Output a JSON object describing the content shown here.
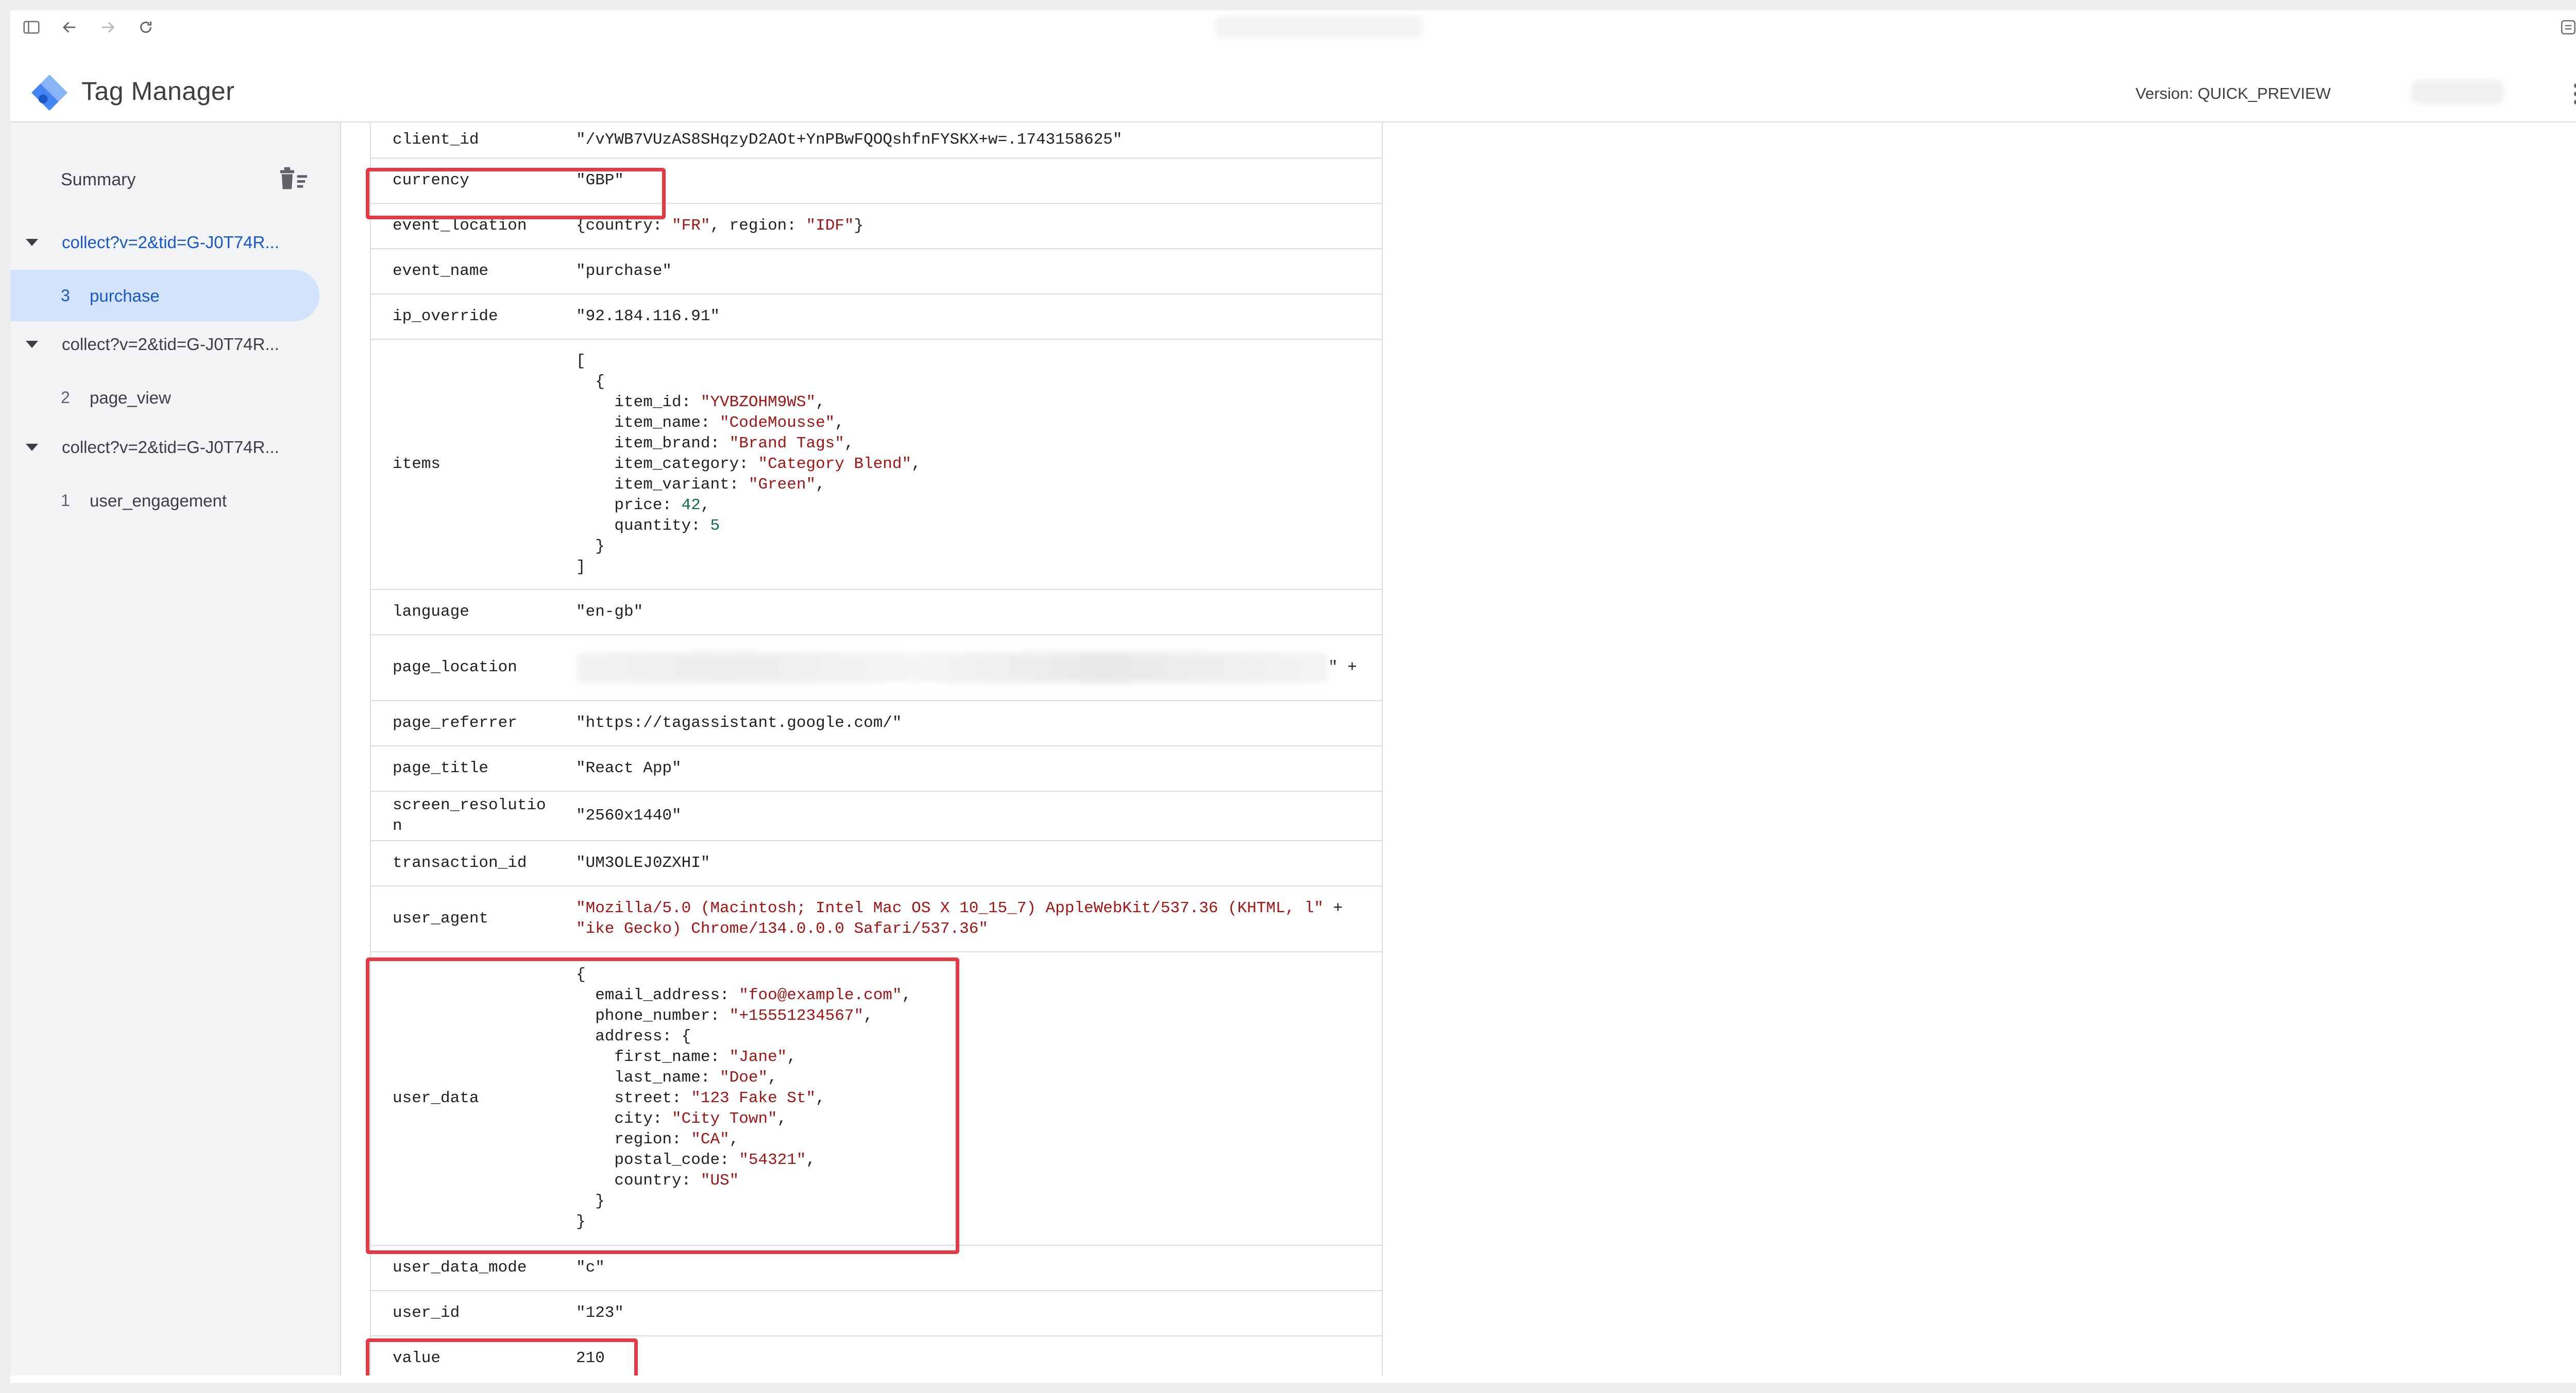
{
  "app": {
    "title": "Tag Manager",
    "version_label": "Version: QUICK_PREVIEW"
  },
  "sidebar": {
    "summary_label": "Summary",
    "requests": [
      {
        "label": "collect?v=2&tid=G-J0T74R...",
        "active": true,
        "events": [
          {
            "number": "3",
            "name": "purchase",
            "selected": true
          }
        ]
      },
      {
        "label": "collect?v=2&tid=G-J0T74R...",
        "active": false,
        "events": [
          {
            "number": "2",
            "name": "page_view",
            "selected": false
          }
        ]
      },
      {
        "label": "collect?v=2&tid=G-J0T74R...",
        "active": false,
        "events": [
          {
            "number": "1",
            "name": "user_engagement",
            "selected": false
          }
        ]
      }
    ]
  },
  "params": {
    "client_id": {
      "key": "client_id",
      "value": "\"/vYWB7VUzAS8SHqzyD2AOt+YnPBwFQOQshfnFYSKX+w=.1743158625\""
    },
    "currency": {
      "key": "currency",
      "value": "\"GBP\""
    },
    "event_location": {
      "key": "event_location",
      "pre": "{country: ",
      "country": "\"FR\"",
      "mid": ", region: ",
      "region": "\"IDF\"",
      "post": "}"
    },
    "event_name": {
      "key": "event_name",
      "value": "\"purchase\""
    },
    "ip_override": {
      "key": "ip_override",
      "value": "\"92.184.116.91\""
    },
    "items": {
      "key": "items",
      "item_id": "\"YVBZOHM9WS\"",
      "item_name": "\"CodeMousse\"",
      "item_brand": "\"Brand Tags\"",
      "item_category": "\"Category Blend\"",
      "item_variant": "\"Green\"",
      "price": "42",
      "quantity": "5"
    },
    "language": {
      "key": "language",
      "value": "\"en-gb\""
    },
    "page_location": {
      "key": "page_location",
      "suffix": "\" +"
    },
    "page_referrer": {
      "key": "page_referrer",
      "value": "\"https://tagassistant.google.com/\""
    },
    "page_title": {
      "key": "page_title",
      "value": "\"React App\""
    },
    "screen_resolution": {
      "key": "screen_resolution",
      "value": "\"2560x1440\""
    },
    "transaction_id": {
      "key": "transaction_id",
      "value": "\"UM3OLEJ0ZXHI\""
    },
    "user_agent": {
      "key": "user_agent",
      "line1": "\"Mozilla/5.0 (Macintosh; Intel Mac OS X 10_15_7) AppleWebKit/537.36 (KHTML, l\"",
      "line1_op": " +",
      "line2": "\"ike Gecko) Chrome/134.0.0.0 Safari/537.36\""
    },
    "user_data": {
      "key": "user_data",
      "email_address": "\"foo@example.com\"",
      "phone_number": "\"+15551234567\"",
      "first_name": "\"Jane\"",
      "last_name": "\"Doe\"",
      "street": "\"123 Fake St\"",
      "city": "\"City Town\"",
      "region": "\"CA\"",
      "postal_code": "\"54321\"",
      "country": "\"US\""
    },
    "user_data_mode": {
      "key": "user_data_mode",
      "value": "\"c\""
    },
    "user_id": {
      "key": "user_id",
      "value": "\"123\""
    },
    "value": {
      "key": "value",
      "value": "210"
    }
  },
  "colors": {
    "highlight": "#e63946",
    "string": "#a31515",
    "number": "#0b6e4f",
    "selected_bg": "#d3e3fd",
    "active_link": "#1a57c8"
  },
  "highlighted_params": [
    "currency",
    "user_data",
    "value"
  ]
}
